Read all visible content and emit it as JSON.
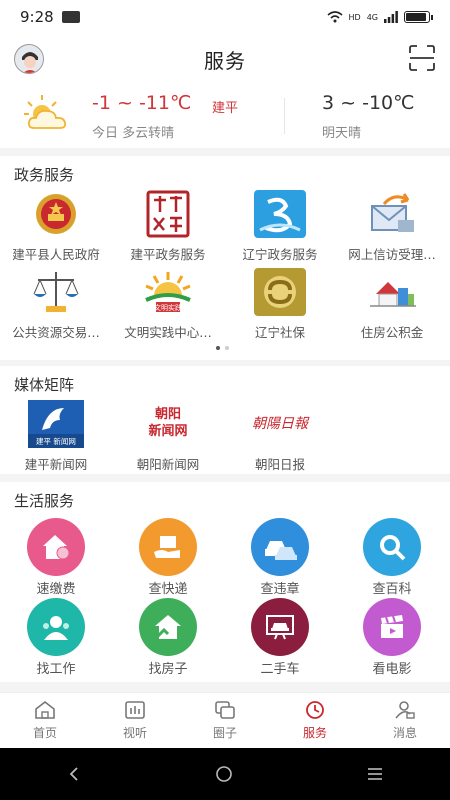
{
  "status": {
    "time": "9:28",
    "signal": "4G",
    "network": "HD"
  },
  "header": {
    "title": "服务"
  },
  "weather": {
    "today_temp": "-1 ~ -11℃",
    "city": "建平",
    "today_desc": "今日 多云转晴",
    "tomorrow_temp": "3 ~ -10℃",
    "tomorrow_desc": "明天晴"
  },
  "gov": {
    "title": "政务服务",
    "items": [
      {
        "label": "建平县人民政府"
      },
      {
        "label": "建平政务服务"
      },
      {
        "label": "辽宁政务服务"
      },
      {
        "label": "网上信访受理…"
      },
      {
        "label": "公共资源交易…"
      },
      {
        "label": "文明实践中心…"
      },
      {
        "label": "辽宁社保"
      },
      {
        "label": "住房公积金"
      }
    ],
    "icon_text": {
      "wenming": "文明实践"
    }
  },
  "media": {
    "title": "媒体矩阵",
    "items": [
      {
        "label": "建平新闻网",
        "logo_text": "建平 新闻网"
      },
      {
        "label": "朝阳新闻网",
        "logo_text_1": "朝阳",
        "logo_text_2": "新闻网"
      },
      {
        "label": "朝阳日报",
        "logo_text": "朝陽日報"
      }
    ]
  },
  "life": {
    "title": "生活服务",
    "items": [
      {
        "label": "速缴费",
        "color": "#e85a8c"
      },
      {
        "label": "查快递",
        "color": "#f29a2e"
      },
      {
        "label": "查违章",
        "color": "#2f8fdc"
      },
      {
        "label": "查百科",
        "color": "#2fa5e0"
      },
      {
        "label": "找工作",
        "color": "#1fb7a8"
      },
      {
        "label": "找房子",
        "color": "#3fae5a"
      },
      {
        "label": "二手车",
        "color": "#8b1e3f"
      },
      {
        "label": "看电影",
        "color": "#c35bd0"
      }
    ]
  },
  "tabs": [
    {
      "label": "首页"
    },
    {
      "label": "视听"
    },
    {
      "label": "圈子"
    },
    {
      "label": "服务"
    },
    {
      "label": "消息"
    }
  ],
  "colors": {
    "accent": "#c8282e"
  }
}
